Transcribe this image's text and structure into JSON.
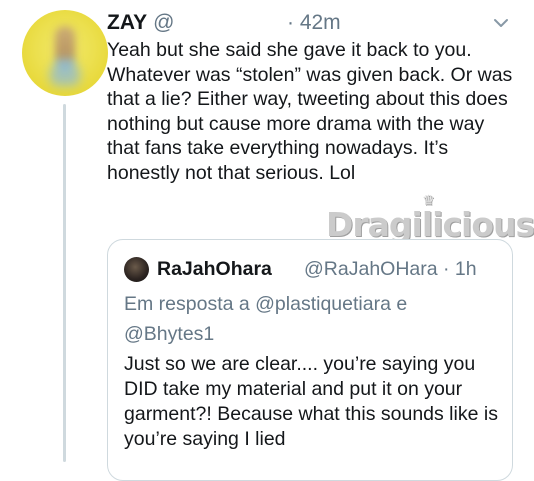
{
  "tweet": {
    "author_name": "ZAY",
    "handle": "@",
    "time": "· 42m",
    "text": "Yeah but she said she gave it back to you. Whatever was “stolen” was given back. Or was that a lie? Either way, tweeting about this does nothing but cause more drama with the way that fans take everything nowadays. It’s honestly not that serious. Lol"
  },
  "watermark": {
    "text": "Dragilicious"
  },
  "quoted_tweet": {
    "author_name": "RaJahOhara",
    "handle_time": "@RaJahOHara · 1h",
    "reply_context": "Em resposta a @plastiquetiara e @Bhytes1",
    "text": "Just so we are clear.... you’re saying you DID take my material and put it on your garment?!  Because what this sounds like is you’re saying I lied"
  },
  "icons": [
    "chevron-down-icon"
  ],
  "colors": {
    "text": "#14171a",
    "secondary": "#657786",
    "border": "#cfd9de"
  }
}
